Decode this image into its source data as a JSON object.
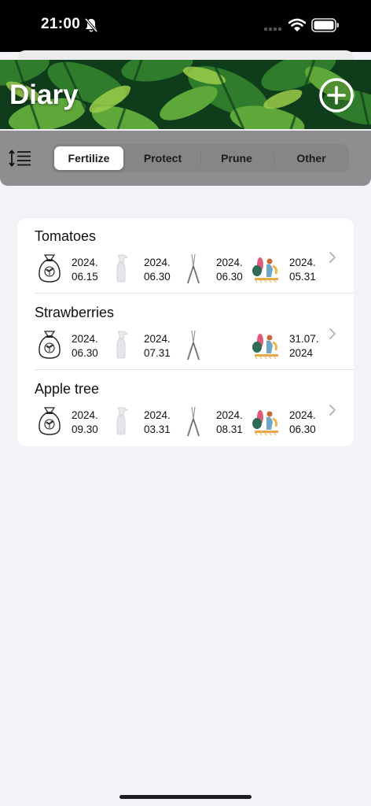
{
  "status": {
    "time": "21:00"
  },
  "header": {
    "title": "Diary"
  },
  "tabs": [
    {
      "label": "Fertilize",
      "active": true
    },
    {
      "label": "Protect",
      "active": false
    },
    {
      "label": "Prune",
      "active": false
    },
    {
      "label": "Other",
      "active": false
    }
  ],
  "plants": [
    {
      "name": "Tomatoes",
      "fertilize": {
        "line1": "2024.",
        "line2": "06.15"
      },
      "protect": {
        "line1": "2024.",
        "line2": "06.30"
      },
      "prune": {
        "line1": "2024.",
        "line2": "06.30"
      },
      "other": {
        "line1": "2024.",
        "line2": "05.31"
      }
    },
    {
      "name": "Strawberries",
      "fertilize": {
        "line1": "2024.",
        "line2": "06.30"
      },
      "protect": {
        "line1": "2024.",
        "line2": "07.31"
      },
      "prune": {
        "line1": "",
        "line2": ""
      },
      "other": {
        "line1": "31.07.",
        "line2": "2024"
      }
    },
    {
      "name": "Apple tree",
      "fertilize": {
        "line1": "2024.",
        "line2": "09.30"
      },
      "protect": {
        "line1": "2024.",
        "line2": "03.31"
      },
      "prune": {
        "line1": "2024.",
        "line2": "08.31"
      },
      "other": {
        "line1": "2024.",
        "line2": "06.30"
      }
    }
  ],
  "icons": {
    "fertilize": "fertilizer-bag-icon",
    "protect": "spray-bottle-icon",
    "prune": "pruning-shears-icon",
    "other": "gardener-icon"
  },
  "colors": {
    "background": "#f2f2f7",
    "toolbar": "#8e8e90",
    "header": "#0e3b18",
    "accent": "#ffffff"
  }
}
